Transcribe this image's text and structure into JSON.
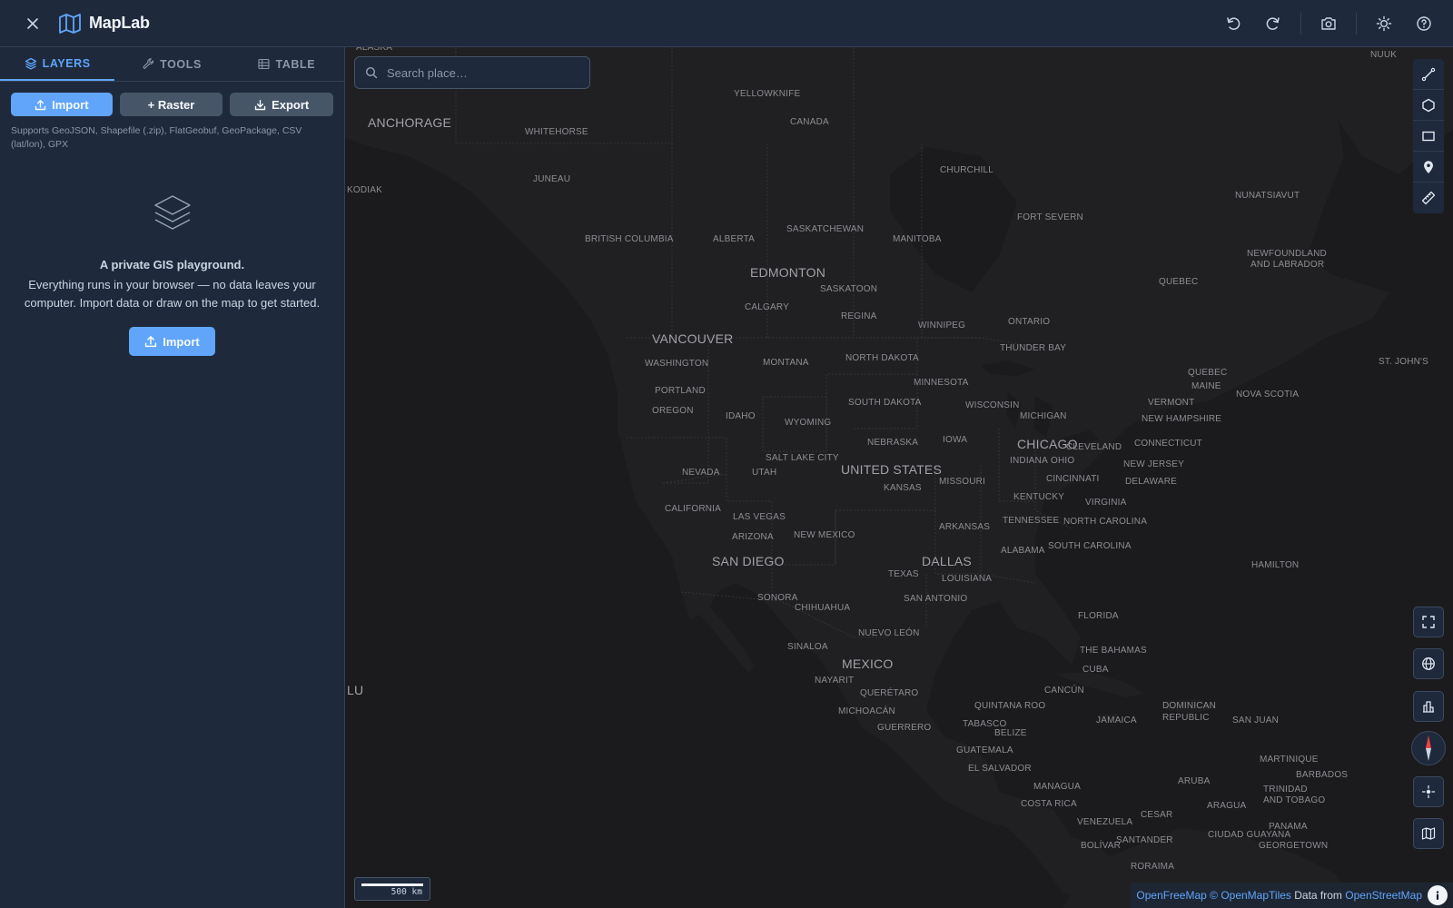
{
  "app": {
    "title": "MapLab"
  },
  "header": {
    "icons": [
      "close-icon",
      "map-logo-icon",
      "undo-icon",
      "redo-icon",
      "camera-icon",
      "sun-icon",
      "help-icon"
    ]
  },
  "tabs": [
    {
      "label": "LAYERS",
      "icon": "layers-icon",
      "active": true
    },
    {
      "label": "TOOLS",
      "icon": "wrench-icon",
      "active": false
    },
    {
      "label": "TABLE",
      "icon": "table-icon",
      "active": false
    }
  ],
  "layers_panel": {
    "import_label": "Import",
    "raster_label": "+ Raster",
    "export_label": "Export",
    "supports_text": "Supports GeoJSON, Shapefile (.zip), FlatGeobuf, GeoPackage, CSV (lat/lon), GPX",
    "empty_title": "A private GIS playground.",
    "empty_description": "Everything runs in your browser — no data leaves your computer. Import data or draw on the map to get started.",
    "empty_import_label": "Import"
  },
  "search": {
    "placeholder": "Search place…"
  },
  "map": {
    "labels": [
      "ALASKA",
      "NUUK",
      "YELLOWKNIFE",
      "ANCHORAGE",
      "CANADA",
      "WHITEHORSE",
      "JUNEAU",
      "CHURCHILL",
      "NUNATSIAVUT",
      "KODIAK",
      "FORT SEVERN",
      "BRITISH COLUMBIA",
      "ALBERTA",
      "SASKATCHEWAN",
      "MANITOBA",
      "NEWFOUNDLAND",
      "AND LABRADOR",
      "EDMONTON",
      "QUEBEC",
      "SASKATOON",
      "CALGARY",
      "REGINA",
      "ONTARIO",
      "WINNIPEG",
      "VANCOUVER",
      "THUNDER BAY",
      "ST. JOHN'S",
      "WASHINGTON",
      "MONTANA",
      "NORTH DAKOTA",
      "QUEBEC",
      "MINNESOTA",
      "MAINE",
      "PORTLAND",
      "NOVA SCOTIA",
      "SOUTH DAKOTA",
      "VERMONT",
      "WISCONSIN",
      "OREGON",
      "IDAHO",
      "WYOMING",
      "MICHIGAN",
      "NEW HAMPSHIRE",
      "IOWA",
      "CHICAGO",
      "NEBRASKA",
      "CONNECTICUT",
      "CLEVELAND",
      "SALT LAKE CITY",
      "INDIANA",
      "OHIO",
      "NEW JERSEY",
      "NEVADA",
      "UTAH",
      "UNITED STATES",
      "CINCINNATI",
      "DELAWARE",
      "MISSOURI",
      "KANSAS",
      "KENTUCKY",
      "VIRGINIA",
      "CALIFORNIA",
      "LAS VEGAS",
      "TENNESSEE",
      "NORTH CAROLINA",
      "ARKANSAS",
      "ARIZONA",
      "NEW MEXICO",
      "ALABAMA",
      "SOUTH CAROLINA",
      "SAN DIEGO",
      "DALLAS",
      "HAMILTON",
      "TEXAS",
      "LOUISIANA",
      "SONORA",
      "SAN ANTONIO",
      "CHIHUAHUA",
      "FLORIDA",
      "NUEVO LEÓN",
      "SINALOA",
      "THE BAHAMAS",
      "MEXICO",
      "CUBA",
      "NAYARIT",
      "LU",
      "QUERÉTARO",
      "CANCÚN",
      "QUINTANA ROO",
      "DOMINICAN",
      "REPUBLIC",
      "MICHOACÁN",
      "TABASCO",
      "JAMAICA",
      "SAN JUAN",
      "GUERRERO",
      "BELIZE",
      "GUATEMALA",
      "MARTINIQUE",
      "EL SALVADOR",
      "BARBADOS",
      "ARUBA",
      "MANAGUA",
      "TRINIDAD",
      "AND TOBAGO",
      "COSTA RICA",
      "ARAGUA",
      "CESAR",
      "PANAMA",
      "VENEZUELA",
      "CIUDAD GUAYANA",
      "SANTANDER",
      "GEORGETOWN",
      "BOLÍVAR",
      "RORAIMA"
    ]
  },
  "draw_tools": [
    "line-icon",
    "polygon-icon",
    "rectangle-icon",
    "marker-icon",
    "ruler-icon"
  ],
  "map_controls": [
    "fullscreen-icon",
    "globe-icon",
    "buildings-3d-icon",
    "compass-icon",
    "locate-icon",
    "basemap-icon"
  ],
  "scale": {
    "label": "500 km"
  },
  "attribution": {
    "part1": "OpenFreeMap",
    "part2": "© OpenMapTiles",
    "part3": "Data from",
    "part4": "OpenStreetMap"
  },
  "colors": {
    "accent": "#60a5fa",
    "panel": "#1e293b",
    "map_land": "#202022",
    "map_water": "#1b1b1d"
  }
}
